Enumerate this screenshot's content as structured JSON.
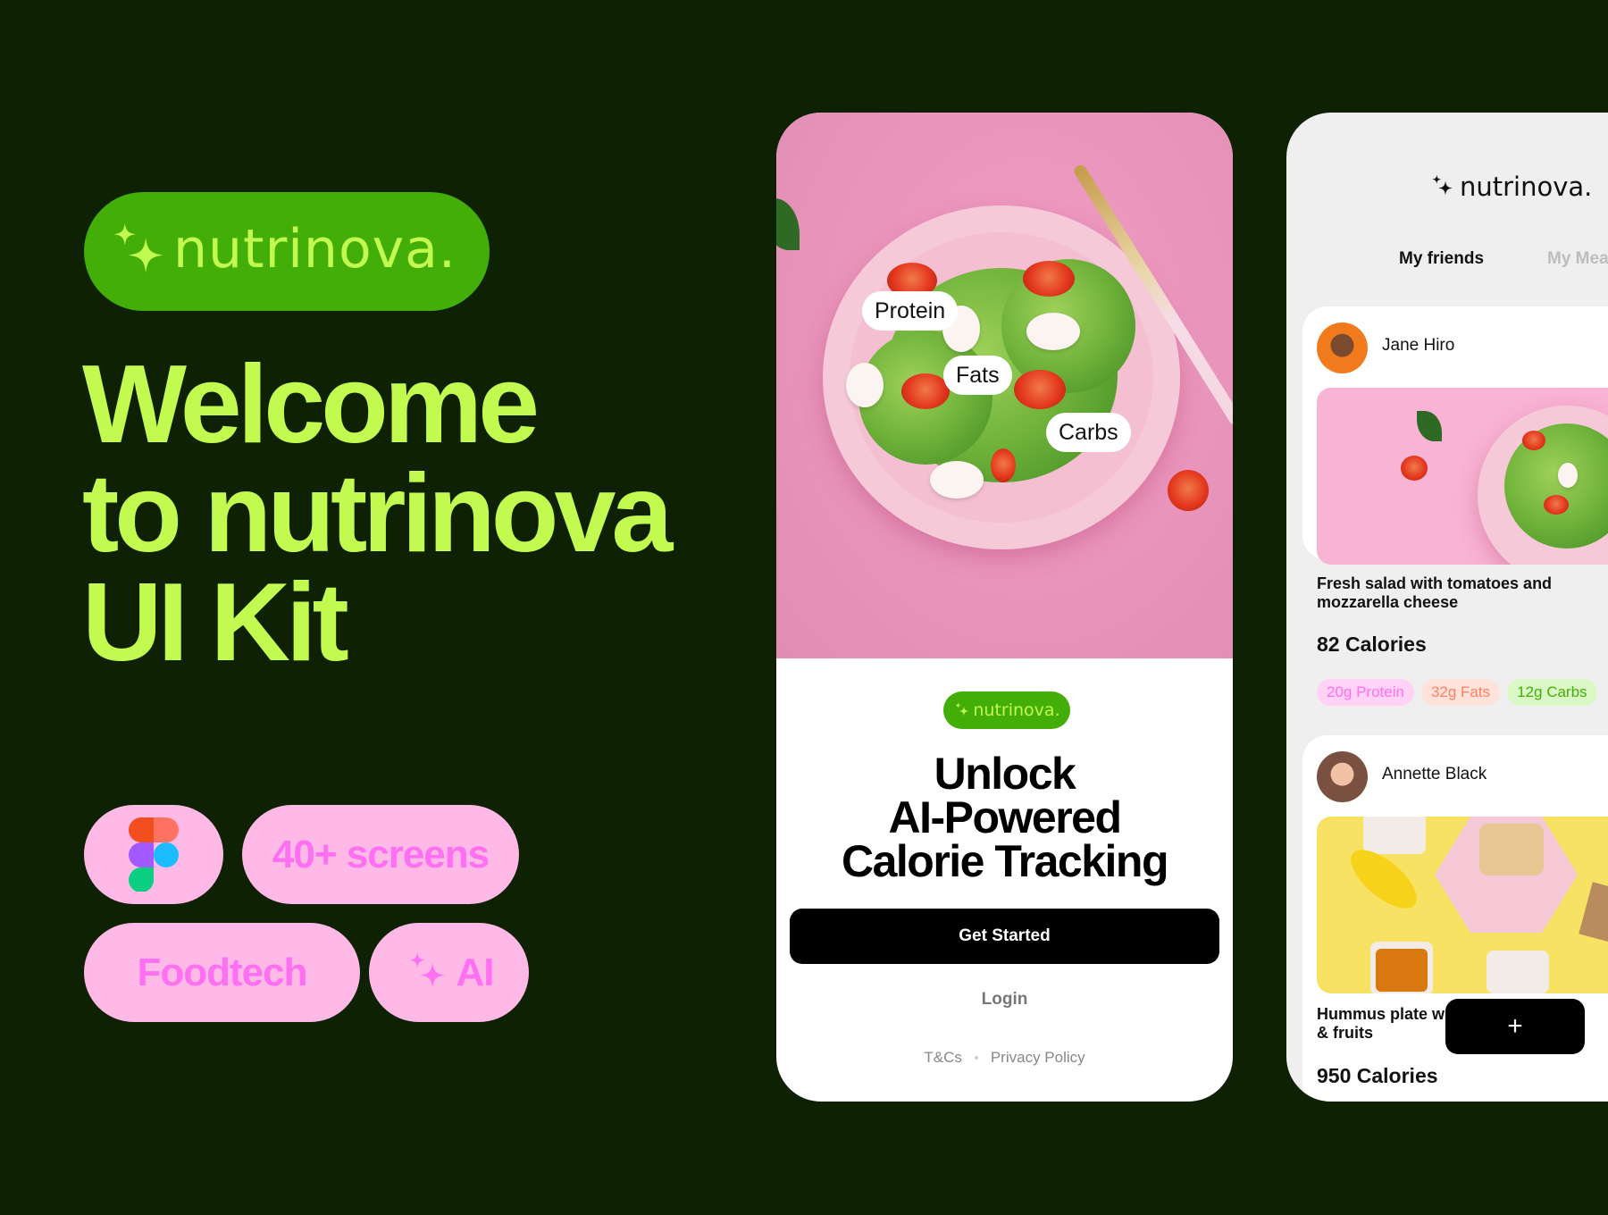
{
  "brand": {
    "name": "nutrinova.",
    "colors": {
      "background": "#0f2103",
      "brand_green": "#43ae07",
      "lime": "#c2fa50",
      "tag_pink": "#ffb9e6",
      "tag_text": "#ff6ff1"
    }
  },
  "hero": {
    "headline": "Welcome\nto nutrinova\nUI Kit"
  },
  "tags": [
    {
      "icon": "figma-logo-icon"
    },
    {
      "label": "40+ screens"
    },
    {
      "label": "Foodtech"
    },
    {
      "label": "AI",
      "icon": "sparkle-icon"
    }
  ],
  "phone_welcome": {
    "macro_labels": [
      "Protein",
      "Fats",
      "Carbs"
    ],
    "logo": "nutrinova.",
    "title": "Unlock\nAI-Powered\nCalorie Tracking",
    "primary_button": "Get Started",
    "secondary_button": "Login",
    "footer_links": [
      "T&Cs",
      "Privacy Policy"
    ]
  },
  "phone_feed": {
    "logo": "nutrinova.",
    "tabs": [
      {
        "label": "My friends",
        "active": true
      },
      {
        "label": "My Meals",
        "visible_text": "My Mea",
        "active": false
      }
    ],
    "posts": [
      {
        "user": "Jane Hiro",
        "meal": "Fresh salad with tomatoes and mozzarella cheese",
        "calories": "82 Calories",
        "macros": [
          "20g Protein",
          "32g Fats",
          "12g Carbs"
        ]
      },
      {
        "user": "Annette Black",
        "meal": "Hummus plate w\n& fruits",
        "calories": "950 Calories"
      }
    ],
    "add_button": "+"
  }
}
